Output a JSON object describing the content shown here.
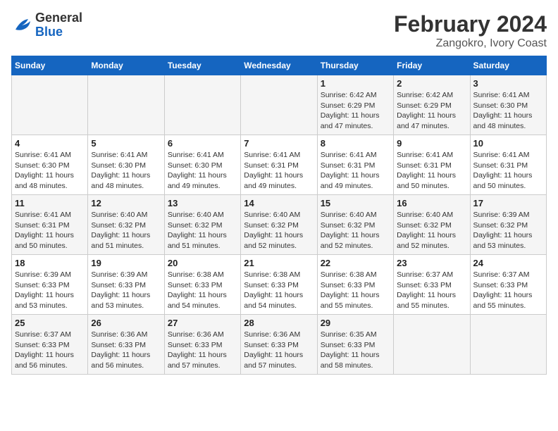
{
  "header": {
    "logo_general": "General",
    "logo_blue": "Blue",
    "title": "February 2024",
    "subtitle": "Zangokro, Ivory Coast"
  },
  "days_of_week": [
    "Sunday",
    "Monday",
    "Tuesday",
    "Wednesday",
    "Thursday",
    "Friday",
    "Saturday"
  ],
  "weeks": [
    [
      {
        "day": "",
        "info": ""
      },
      {
        "day": "",
        "info": ""
      },
      {
        "day": "",
        "info": ""
      },
      {
        "day": "",
        "info": ""
      },
      {
        "day": "1",
        "info": "Sunrise: 6:42 AM\nSunset: 6:29 PM\nDaylight: 11 hours\nand 47 minutes."
      },
      {
        "day": "2",
        "info": "Sunrise: 6:42 AM\nSunset: 6:29 PM\nDaylight: 11 hours\nand 47 minutes."
      },
      {
        "day": "3",
        "info": "Sunrise: 6:41 AM\nSunset: 6:30 PM\nDaylight: 11 hours\nand 48 minutes."
      }
    ],
    [
      {
        "day": "4",
        "info": "Sunrise: 6:41 AM\nSunset: 6:30 PM\nDaylight: 11 hours\nand 48 minutes."
      },
      {
        "day": "5",
        "info": "Sunrise: 6:41 AM\nSunset: 6:30 PM\nDaylight: 11 hours\nand 48 minutes."
      },
      {
        "day": "6",
        "info": "Sunrise: 6:41 AM\nSunset: 6:30 PM\nDaylight: 11 hours\nand 49 minutes."
      },
      {
        "day": "7",
        "info": "Sunrise: 6:41 AM\nSunset: 6:31 PM\nDaylight: 11 hours\nand 49 minutes."
      },
      {
        "day": "8",
        "info": "Sunrise: 6:41 AM\nSunset: 6:31 PM\nDaylight: 11 hours\nand 49 minutes."
      },
      {
        "day": "9",
        "info": "Sunrise: 6:41 AM\nSunset: 6:31 PM\nDaylight: 11 hours\nand 50 minutes."
      },
      {
        "day": "10",
        "info": "Sunrise: 6:41 AM\nSunset: 6:31 PM\nDaylight: 11 hours\nand 50 minutes."
      }
    ],
    [
      {
        "day": "11",
        "info": "Sunrise: 6:41 AM\nSunset: 6:31 PM\nDaylight: 11 hours\nand 50 minutes."
      },
      {
        "day": "12",
        "info": "Sunrise: 6:40 AM\nSunset: 6:32 PM\nDaylight: 11 hours\nand 51 minutes."
      },
      {
        "day": "13",
        "info": "Sunrise: 6:40 AM\nSunset: 6:32 PM\nDaylight: 11 hours\nand 51 minutes."
      },
      {
        "day": "14",
        "info": "Sunrise: 6:40 AM\nSunset: 6:32 PM\nDaylight: 11 hours\nand 52 minutes."
      },
      {
        "day": "15",
        "info": "Sunrise: 6:40 AM\nSunset: 6:32 PM\nDaylight: 11 hours\nand 52 minutes."
      },
      {
        "day": "16",
        "info": "Sunrise: 6:40 AM\nSunset: 6:32 PM\nDaylight: 11 hours\nand 52 minutes."
      },
      {
        "day": "17",
        "info": "Sunrise: 6:39 AM\nSunset: 6:32 PM\nDaylight: 11 hours\nand 53 minutes."
      }
    ],
    [
      {
        "day": "18",
        "info": "Sunrise: 6:39 AM\nSunset: 6:33 PM\nDaylight: 11 hours\nand 53 minutes."
      },
      {
        "day": "19",
        "info": "Sunrise: 6:39 AM\nSunset: 6:33 PM\nDaylight: 11 hours\nand 53 minutes."
      },
      {
        "day": "20",
        "info": "Sunrise: 6:38 AM\nSunset: 6:33 PM\nDaylight: 11 hours\nand 54 minutes."
      },
      {
        "day": "21",
        "info": "Sunrise: 6:38 AM\nSunset: 6:33 PM\nDaylight: 11 hours\nand 54 minutes."
      },
      {
        "day": "22",
        "info": "Sunrise: 6:38 AM\nSunset: 6:33 PM\nDaylight: 11 hours\nand 55 minutes."
      },
      {
        "day": "23",
        "info": "Sunrise: 6:37 AM\nSunset: 6:33 PM\nDaylight: 11 hours\nand 55 minutes."
      },
      {
        "day": "24",
        "info": "Sunrise: 6:37 AM\nSunset: 6:33 PM\nDaylight: 11 hours\nand 55 minutes."
      }
    ],
    [
      {
        "day": "25",
        "info": "Sunrise: 6:37 AM\nSunset: 6:33 PM\nDaylight: 11 hours\nand 56 minutes."
      },
      {
        "day": "26",
        "info": "Sunrise: 6:36 AM\nSunset: 6:33 PM\nDaylight: 11 hours\nand 56 minutes."
      },
      {
        "day": "27",
        "info": "Sunrise: 6:36 AM\nSunset: 6:33 PM\nDaylight: 11 hours\nand 57 minutes."
      },
      {
        "day": "28",
        "info": "Sunrise: 6:36 AM\nSunset: 6:33 PM\nDaylight: 11 hours\nand 57 minutes."
      },
      {
        "day": "29",
        "info": "Sunrise: 6:35 AM\nSunset: 6:33 PM\nDaylight: 11 hours\nand 58 minutes."
      },
      {
        "day": "",
        "info": ""
      },
      {
        "day": "",
        "info": ""
      }
    ]
  ]
}
